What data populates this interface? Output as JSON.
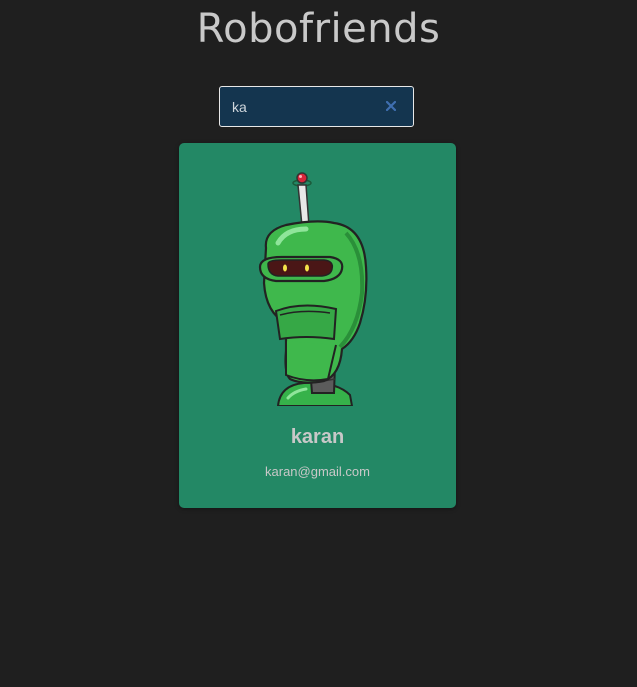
{
  "app": {
    "title": "Robofriends"
  },
  "search": {
    "value": "ka",
    "clear_icon": "close-x-icon"
  },
  "robots": [
    {
      "name": "karan",
      "email": "karan@gmail.com",
      "avatar": "green-robot-avatar"
    }
  ],
  "colors": {
    "background": "#1f1f1f",
    "card": "#238865",
    "search_bg": "#14354f",
    "text": "#c8c8c8"
  }
}
